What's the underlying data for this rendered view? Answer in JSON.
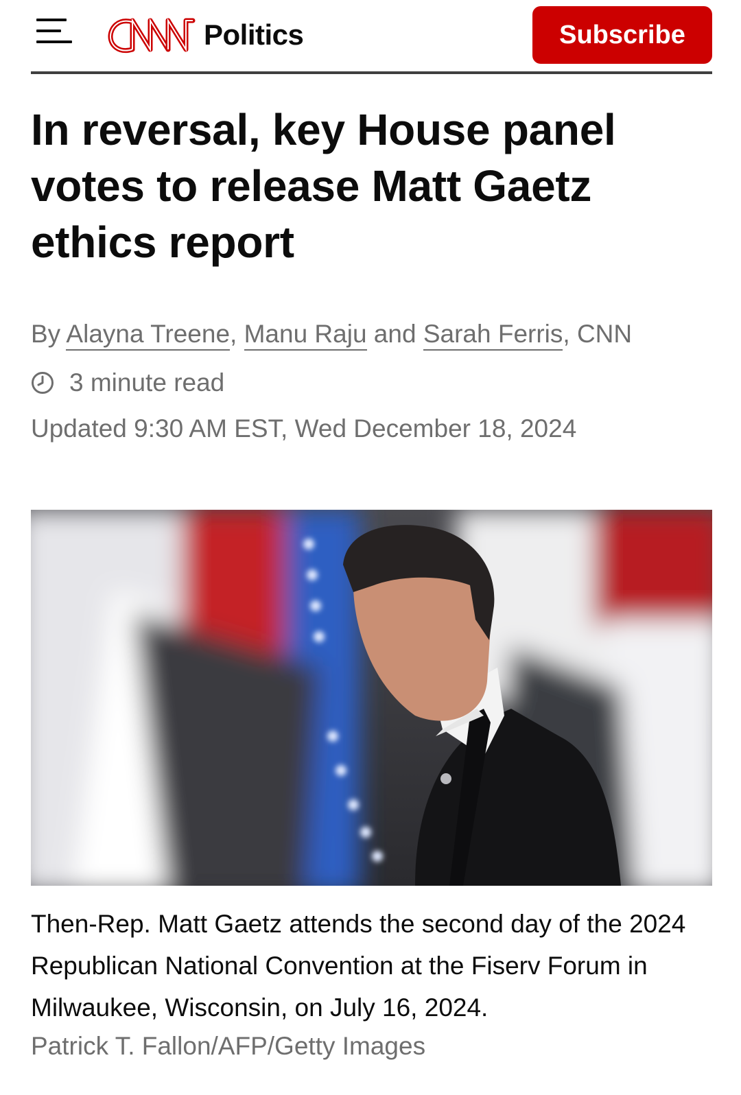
{
  "header": {
    "logo_text": "CNN",
    "section": "Politics",
    "subscribe_label": "Subscribe",
    "menu_icon": "hamburger-menu-icon"
  },
  "article": {
    "headline": "In reversal, key House panel votes to release Matt Gaetz ethics report",
    "byline": {
      "prefix": "By ",
      "authors": [
        "Alayna Treene",
        "Manu Raju",
        "Sarah Ferris"
      ],
      "sep1": ", ",
      "sep2": " and ",
      "suffix": ", CNN"
    },
    "read_time": "3 minute read",
    "read_time_icon": "clock-icon",
    "updated": "Updated 9:30 AM EST, Wed December 18, 2024"
  },
  "image": {
    "caption": "Then-Rep. Matt Gaetz attends the second day of the 2024 Republican National Convention at the Fiserv Forum in Milwaukee, Wisconsin, on July 16, 2024.",
    "credit": "Patrick T. Fallon/AFP/Getty Images"
  },
  "colors": {
    "brand_red": "#cc0000",
    "text": "#0c0c0c",
    "muted": "#6e6e6e"
  }
}
